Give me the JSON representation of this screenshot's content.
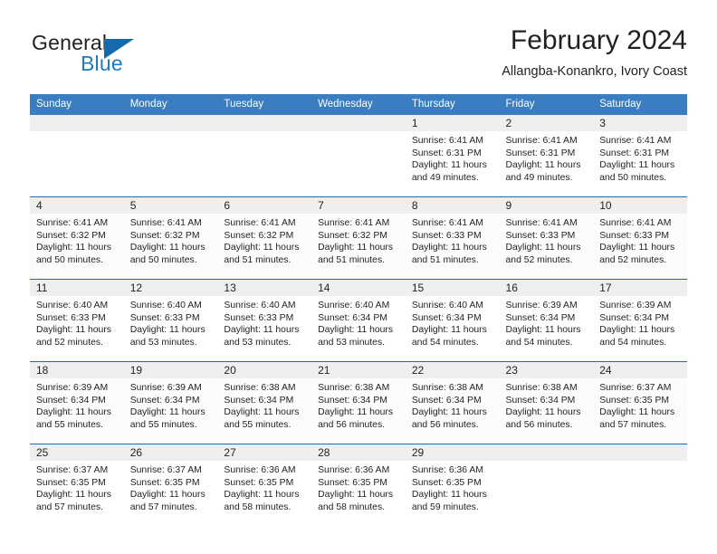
{
  "brand": {
    "name_top": "General",
    "name_bottom": "Blue",
    "accent_color": "#1569ad",
    "text_color": "#231f20"
  },
  "header": {
    "title": "February 2024",
    "subtitle": "Allangba-Konankro, Ivory Coast"
  },
  "calendar": {
    "header_bg": "#3a7dc0",
    "header_text": "#ffffff",
    "row_divider_color": "#1f6cb0",
    "daynum_band_color": "#efefef",
    "weekdays": [
      "Sunday",
      "Monday",
      "Tuesday",
      "Wednesday",
      "Thursday",
      "Friday",
      "Saturday"
    ],
    "weeks": [
      [
        {
          "day": "",
          "lines": []
        },
        {
          "day": "",
          "lines": []
        },
        {
          "day": "",
          "lines": []
        },
        {
          "day": "",
          "lines": []
        },
        {
          "day": "1",
          "lines": [
            "Sunrise: 6:41 AM",
            "Sunset: 6:31 PM",
            "Daylight: 11 hours",
            "and 49 minutes."
          ]
        },
        {
          "day": "2",
          "lines": [
            "Sunrise: 6:41 AM",
            "Sunset: 6:31 PM",
            "Daylight: 11 hours",
            "and 49 minutes."
          ]
        },
        {
          "day": "3",
          "lines": [
            "Sunrise: 6:41 AM",
            "Sunset: 6:31 PM",
            "Daylight: 11 hours",
            "and 50 minutes."
          ]
        }
      ],
      [
        {
          "day": "4",
          "lines": [
            "Sunrise: 6:41 AM",
            "Sunset: 6:32 PM",
            "Daylight: 11 hours",
            "and 50 minutes."
          ]
        },
        {
          "day": "5",
          "lines": [
            "Sunrise: 6:41 AM",
            "Sunset: 6:32 PM",
            "Daylight: 11 hours",
            "and 50 minutes."
          ]
        },
        {
          "day": "6",
          "lines": [
            "Sunrise: 6:41 AM",
            "Sunset: 6:32 PM",
            "Daylight: 11 hours",
            "and 51 minutes."
          ]
        },
        {
          "day": "7",
          "lines": [
            "Sunrise: 6:41 AM",
            "Sunset: 6:32 PM",
            "Daylight: 11 hours",
            "and 51 minutes."
          ]
        },
        {
          "day": "8",
          "lines": [
            "Sunrise: 6:41 AM",
            "Sunset: 6:33 PM",
            "Daylight: 11 hours",
            "and 51 minutes."
          ]
        },
        {
          "day": "9",
          "lines": [
            "Sunrise: 6:41 AM",
            "Sunset: 6:33 PM",
            "Daylight: 11 hours",
            "and 52 minutes."
          ]
        },
        {
          "day": "10",
          "lines": [
            "Sunrise: 6:41 AM",
            "Sunset: 6:33 PM",
            "Daylight: 11 hours",
            "and 52 minutes."
          ]
        }
      ],
      [
        {
          "day": "11",
          "lines": [
            "Sunrise: 6:40 AM",
            "Sunset: 6:33 PM",
            "Daylight: 11 hours",
            "and 52 minutes."
          ]
        },
        {
          "day": "12",
          "lines": [
            "Sunrise: 6:40 AM",
            "Sunset: 6:33 PM",
            "Daylight: 11 hours",
            "and 53 minutes."
          ]
        },
        {
          "day": "13",
          "lines": [
            "Sunrise: 6:40 AM",
            "Sunset: 6:33 PM",
            "Daylight: 11 hours",
            "and 53 minutes."
          ]
        },
        {
          "day": "14",
          "lines": [
            "Sunrise: 6:40 AM",
            "Sunset: 6:34 PM",
            "Daylight: 11 hours",
            "and 53 minutes."
          ]
        },
        {
          "day": "15",
          "lines": [
            "Sunrise: 6:40 AM",
            "Sunset: 6:34 PM",
            "Daylight: 11 hours",
            "and 54 minutes."
          ]
        },
        {
          "day": "16",
          "lines": [
            "Sunrise: 6:39 AM",
            "Sunset: 6:34 PM",
            "Daylight: 11 hours",
            "and 54 minutes."
          ]
        },
        {
          "day": "17",
          "lines": [
            "Sunrise: 6:39 AM",
            "Sunset: 6:34 PM",
            "Daylight: 11 hours",
            "and 54 minutes."
          ]
        }
      ],
      [
        {
          "day": "18",
          "lines": [
            "Sunrise: 6:39 AM",
            "Sunset: 6:34 PM",
            "Daylight: 11 hours",
            "and 55 minutes."
          ]
        },
        {
          "day": "19",
          "lines": [
            "Sunrise: 6:39 AM",
            "Sunset: 6:34 PM",
            "Daylight: 11 hours",
            "and 55 minutes."
          ]
        },
        {
          "day": "20",
          "lines": [
            "Sunrise: 6:38 AM",
            "Sunset: 6:34 PM",
            "Daylight: 11 hours",
            "and 55 minutes."
          ]
        },
        {
          "day": "21",
          "lines": [
            "Sunrise: 6:38 AM",
            "Sunset: 6:34 PM",
            "Daylight: 11 hours",
            "and 56 minutes."
          ]
        },
        {
          "day": "22",
          "lines": [
            "Sunrise: 6:38 AM",
            "Sunset: 6:34 PM",
            "Daylight: 11 hours",
            "and 56 minutes."
          ]
        },
        {
          "day": "23",
          "lines": [
            "Sunrise: 6:38 AM",
            "Sunset: 6:34 PM",
            "Daylight: 11 hours",
            "and 56 minutes."
          ]
        },
        {
          "day": "24",
          "lines": [
            "Sunrise: 6:37 AM",
            "Sunset: 6:35 PM",
            "Daylight: 11 hours",
            "and 57 minutes."
          ]
        }
      ],
      [
        {
          "day": "25",
          "lines": [
            "Sunrise: 6:37 AM",
            "Sunset: 6:35 PM",
            "Daylight: 11 hours",
            "and 57 minutes."
          ]
        },
        {
          "day": "26",
          "lines": [
            "Sunrise: 6:37 AM",
            "Sunset: 6:35 PM",
            "Daylight: 11 hours",
            "and 57 minutes."
          ]
        },
        {
          "day": "27",
          "lines": [
            "Sunrise: 6:36 AM",
            "Sunset: 6:35 PM",
            "Daylight: 11 hours",
            "and 58 minutes."
          ]
        },
        {
          "day": "28",
          "lines": [
            "Sunrise: 6:36 AM",
            "Sunset: 6:35 PM",
            "Daylight: 11 hours",
            "and 58 minutes."
          ]
        },
        {
          "day": "29",
          "lines": [
            "Sunrise: 6:36 AM",
            "Sunset: 6:35 PM",
            "Daylight: 11 hours",
            "and 59 minutes."
          ]
        },
        {
          "day": "",
          "lines": []
        },
        {
          "day": "",
          "lines": []
        }
      ]
    ]
  }
}
